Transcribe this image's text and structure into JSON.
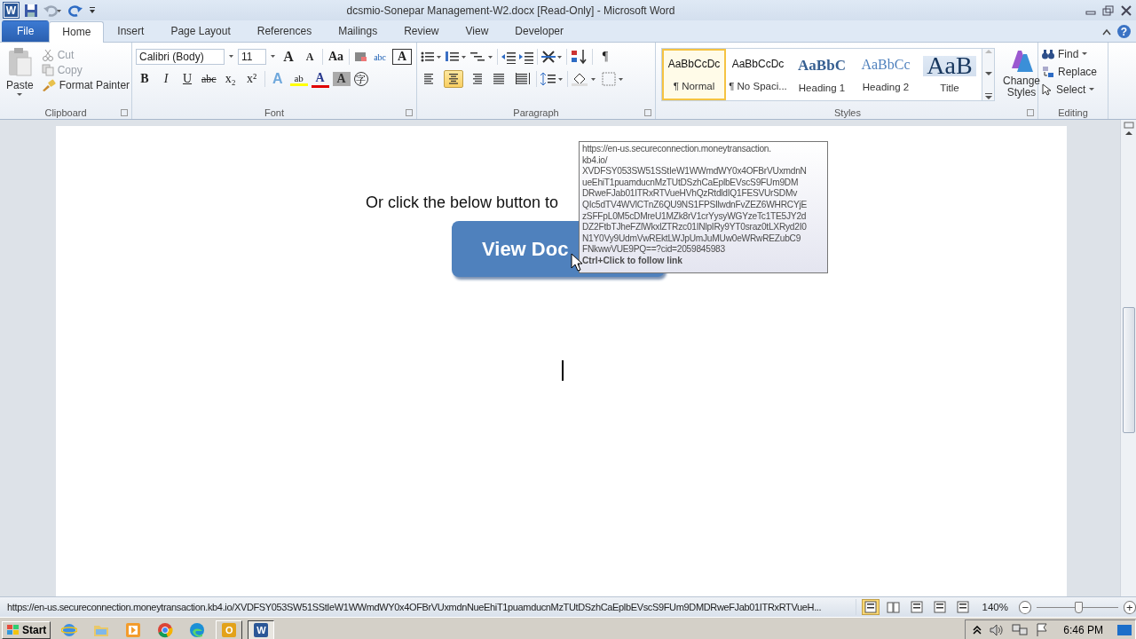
{
  "window": {
    "app_letter": "W",
    "title": "dcsmio-Sonepar Management-W2.docx [Read-Only]  -  Microsoft Word",
    "help": "?"
  },
  "tabs": [
    {
      "label": "File",
      "kind": "file",
      "selected": false
    },
    {
      "label": "Home",
      "kind": "tab",
      "selected": true
    },
    {
      "label": "Insert",
      "kind": "tab",
      "selected": false
    },
    {
      "label": "Page Layout",
      "kind": "tab",
      "selected": false
    },
    {
      "label": "References",
      "kind": "tab",
      "selected": false
    },
    {
      "label": "Mailings",
      "kind": "tab",
      "selected": false
    },
    {
      "label": "Review",
      "kind": "tab",
      "selected": false
    },
    {
      "label": "View",
      "kind": "tab",
      "selected": false
    },
    {
      "label": "Developer",
      "kind": "tab",
      "selected": false
    }
  ],
  "clipboard": {
    "group": "Clipboard",
    "paste": "Paste",
    "items": [
      {
        "label": "Cut",
        "kind": "cut",
        "disabled": true
      },
      {
        "label": "Copy",
        "kind": "copy",
        "disabled": true
      },
      {
        "label": "Format Painter",
        "kind": "painter",
        "disabled": false
      }
    ]
  },
  "font": {
    "group": "Font",
    "family": "Calibri (Body)",
    "size": "11",
    "row1": [
      {
        "kind": "grow",
        "text": "A"
      },
      {
        "kind": "shrink",
        "text": "A"
      },
      {
        "kind": "case",
        "text": "Aa"
      },
      {
        "kind": "clear"
      },
      {
        "kind": "phonetic",
        "text": "abc"
      },
      {
        "kind": "border",
        "text": "A"
      }
    ],
    "row2": [
      {
        "kind": "bold",
        "text": "B"
      },
      {
        "kind": "italic",
        "text": "I"
      },
      {
        "kind": "underline",
        "text": "U"
      },
      {
        "kind": "strike",
        "text": "abc"
      },
      {
        "kind": "sub",
        "text": "x₂"
      },
      {
        "kind": "sup",
        "text": "x²"
      },
      {
        "kind": "effects",
        "text": "A"
      },
      {
        "kind": "highlight",
        "text": "ab"
      },
      {
        "kind": "color",
        "text": "A"
      },
      {
        "kind": "shading",
        "text": "A"
      },
      {
        "kind": "enclose",
        "text": "字"
      }
    ]
  },
  "paragraph": {
    "group": "Paragraph",
    "pilcrow": "¶",
    "alignments": [
      {
        "selected": false
      },
      {
        "selected": true
      },
      {
        "selected": false
      },
      {
        "selected": false
      },
      {
        "selected": false
      }
    ]
  },
  "styles": {
    "group": "Styles",
    "change_styles": "Change Styles",
    "items": [
      {
        "preview": "AaBbCcDc",
        "label": "¶ Normal",
        "kind": "normal",
        "selected": true
      },
      {
        "preview": "AaBbCcDc",
        "label": "¶ No Spaci...",
        "kind": "normal",
        "selected": false
      },
      {
        "preview": "AaBbC",
        "label": "Heading 1",
        "kind": "heading1",
        "selected": false
      },
      {
        "preview": "AaBbCc",
        "label": "Heading 2",
        "kind": "heading2",
        "selected": false
      },
      {
        "preview": "AaB",
        "label": "Title",
        "kind": "title",
        "selected": false
      }
    ]
  },
  "editing": {
    "group": "Editing",
    "items": [
      {
        "label": "Find",
        "kind": "find"
      },
      {
        "label": "Replace",
        "kind": "replace"
      },
      {
        "label": "Select",
        "kind": "select"
      }
    ]
  },
  "document": {
    "line": "Or click the below button to",
    "button": "View Doc",
    "tooltip": {
      "lines": [
        "https://en-us.secureconnection.moneytransaction.",
        "kb4.io/",
        "XVDFSY053SW51SStIeW1WWmdWY0x4OFBrVUxmdnN",
        "ueEhiT1puamducnMzTUtDSzhCaEplbEVscS9FUm9DM",
        "DRweFJab01ITRxRTVueHVhQzRtdldIQ1FESVUrSDMv",
        "QIc5dTV4WVlCTnZ6QU9NS1FPSIlwdnFvZEZ6WHRCYjE",
        "zSFFpL0M5cDMreU1MZk8rV1crYysyWGYzeTc1TE5JY2d",
        "DZ2FtbTJheFZlWkxlZTRzc01INlpIRy9YT0sraz0tLXRyd2I0",
        "N1Y0Vy9UdmVwREktLWJpUmJuMUw0eWRwREZubC9",
        "FNkwwVUE9PQ==?cid=2059845983"
      ],
      "hint": "Ctrl+Click to follow link"
    }
  },
  "status_bar": {
    "url": "https://en-us.secureconnection.moneytransaction.kb4.io/XVDFSY053SW51SStIeW1WWmdWY0x4OFBrVUxmdnNueEhiT1puamducnMzTUtDSzhCaEplbEVscS9FUm9DMDRweFJab01ITRxRTVueH...",
    "views": [
      {
        "selected": true
      },
      {
        "selected": false
      },
      {
        "selected": false
      },
      {
        "selected": false
      },
      {
        "selected": false
      }
    ],
    "zoom": "140%",
    "minus": "−",
    "plus": "+",
    "level": 0.5
  },
  "taskbar": {
    "start": "Start",
    "apps": [
      {
        "kind": "ie",
        "selected": false
      },
      {
        "kind": "folder",
        "selected": false
      },
      {
        "kind": "media",
        "selected": false
      },
      {
        "kind": "chrome",
        "selected": false
      },
      {
        "kind": "edge",
        "selected": false
      },
      {
        "kind": "outlook",
        "text": "O",
        "selected": false
      },
      {
        "kind": "word",
        "text": "W",
        "selected": true
      }
    ],
    "time": "6:46 PM"
  }
}
